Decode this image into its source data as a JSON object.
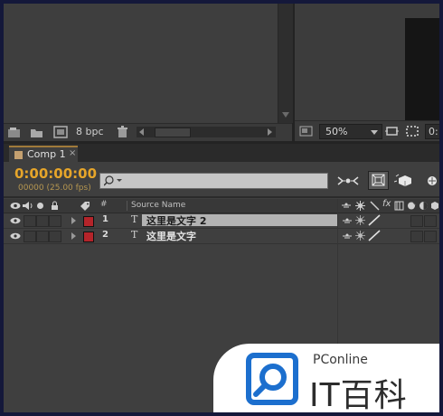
{
  "project_panel": {
    "bit_depth": "8 bpc"
  },
  "viewer_panel": {
    "zoom": "50%",
    "resolution_partial": "0:"
  },
  "timeline": {
    "tab_label": "Comp 1",
    "timecode": "0:00:00:00",
    "frame_info": "00000 (25.00 fps)",
    "search_placeholder": "",
    "columns": {
      "number": "#",
      "source_name": "Source Name",
      "fx": "fx"
    },
    "layers": [
      {
        "number": "1",
        "type_glyph": "T",
        "name": "这里是文字 2",
        "label_color": "#b4242a",
        "selected": true
      },
      {
        "number": "2",
        "type_glyph": "T",
        "name": "这里是文字",
        "label_color": "#b4242a",
        "selected": false
      }
    ]
  },
  "watermark": {
    "brand": "PConline",
    "name": "IT百科"
  },
  "colors": {
    "timecode": "#e6a52a",
    "panel_bg": "#3e3e3e",
    "accent_blue": "#1c6fce"
  }
}
